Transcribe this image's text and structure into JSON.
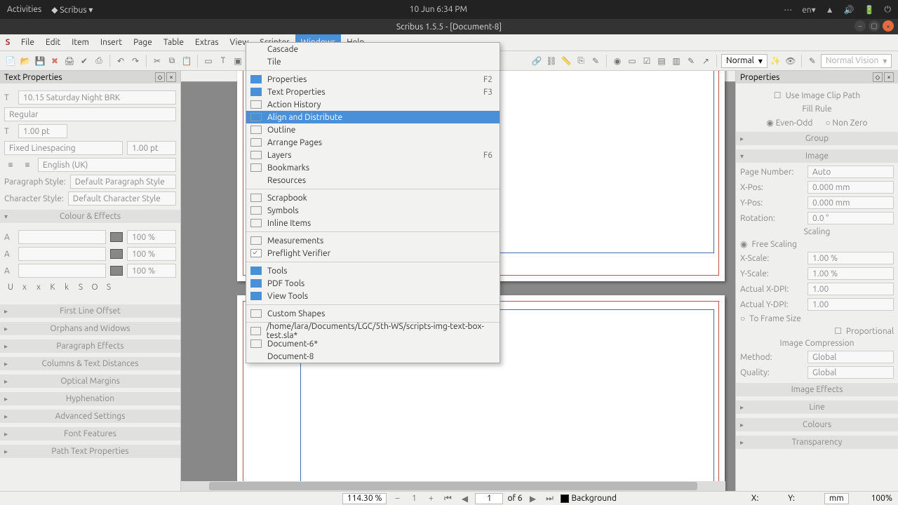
{
  "os": {
    "activities": "Activities",
    "app": "Scribus",
    "clock": "10 Jun   6:34 PM",
    "lang": "en"
  },
  "title": "Scribus 1.5.5 - [Document-8]",
  "menus": [
    "File",
    "Edit",
    "Item",
    "Insert",
    "Page",
    "Table",
    "Extras",
    "View",
    "Scripter",
    "Windows",
    "Help"
  ],
  "active_menu": "Windows",
  "toolbar": {
    "preview_mode": "Normal",
    "vision_mode": "Normal Vision"
  },
  "windows_menu": {
    "groups": [
      [
        {
          "label": "Cascade",
          "checked": null
        },
        {
          "label": "Tile",
          "checked": null
        }
      ],
      [
        {
          "label": "Properties",
          "checked": "on",
          "shortcut": "F2"
        },
        {
          "label": "Text Properties",
          "checked": "on",
          "shortcut": "F3"
        },
        {
          "label": "Action History",
          "checked": "off"
        },
        {
          "label": "Align and Distribute",
          "checked": "off",
          "highlight": true
        },
        {
          "label": "Outline",
          "checked": "off"
        },
        {
          "label": "Arrange Pages",
          "checked": "off"
        },
        {
          "label": "Layers",
          "checked": "off",
          "shortcut": "F6"
        },
        {
          "label": "Bookmarks",
          "checked": "off"
        },
        {
          "label": "Resources",
          "checked": null
        }
      ],
      [
        {
          "label": "Scrapbook",
          "checked": "off"
        },
        {
          "label": "Symbols",
          "checked": "off"
        },
        {
          "label": "Inline Items",
          "checked": "off"
        }
      ],
      [
        {
          "label": "Measurements",
          "checked": "off"
        },
        {
          "label": "Preflight Verifier",
          "checked": "tick"
        }
      ],
      [
        {
          "label": "Tools",
          "checked": "on"
        },
        {
          "label": "PDF Tools",
          "checked": "on"
        },
        {
          "label": "View Tools",
          "checked": "on"
        }
      ],
      [
        {
          "label": "Custom Shapes",
          "checked": "off"
        }
      ],
      [
        {
          "label": "/home/lara/Documents/LGC/5th-WS/scripts-img-text-box-test.sla*",
          "checked": "off"
        },
        {
          "label": "Document-6*",
          "checked": "off"
        },
        {
          "label": "Document-8",
          "checked": null
        }
      ]
    ]
  },
  "leftpanel": {
    "title": "Text Properties",
    "font": "10.15 Saturday Night BRK",
    "style_variant": "Regular",
    "size": "1.00 pt",
    "linespacing_type": "Fixed Linespacing",
    "linespacing_val": "1.00 pt",
    "language": "English (UK)",
    "para_label": "Paragraph Style:",
    "para_value": "Default Paragraph Style",
    "char_label": "Character Style:",
    "char_value": "Default Character Style",
    "colour_header": "Colour & Effects",
    "pct": "100 %",
    "sections": [
      "First Line Offset",
      "Orphans and Widows",
      "Paragraph Effects",
      "Columns & Text Distances",
      "Optical Margins",
      "Hyphenation",
      "Advanced Settings",
      "Font Features",
      "Path Text Properties"
    ]
  },
  "rightpanel": {
    "title": "Properties",
    "use_clip": "Use Image Clip Path",
    "fill_rule": "Fill Rule",
    "evenodd": "Even-Odd",
    "nonzero": "Non Zero",
    "group": "Group",
    "image": "Image",
    "page_label": "Page Number:",
    "page_value": "Auto",
    "xpos_label": "X-Pos:",
    "xpos_value": "0.000 mm",
    "ypos_label": "Y-Pos:",
    "ypos_value": "0.000 mm",
    "rot_label": "Rotation:",
    "rot_value": "0.0 °",
    "scaling": "Scaling",
    "free_scaling": "Free Scaling",
    "xscale_label": "X-Scale:",
    "xscale_value": "1.00 %",
    "yscale_label": "Y-Scale:",
    "yscale_value": "1.00 %",
    "axdpi_label": "Actual X-DPI:",
    "axdpi_value": "1.00",
    "aydpi_label": "Actual Y-DPI:",
    "aydpi_value": "1.00",
    "to_frame": "To Frame Size",
    "proportional": "Proportional",
    "compression": "Image Compression",
    "method_label": "Method:",
    "method_value": "Global",
    "quality_label": "Quality:",
    "quality_value": "Global",
    "effects": "Image Effects",
    "line": "Line",
    "colours": "Colours",
    "transparency": "Transparency"
  },
  "status": {
    "zoom": "114.30 %",
    "page_current": "1",
    "page_total": "of 6",
    "layer": "Background",
    "x_label": "X:",
    "y_label": "Y:",
    "unit": "mm",
    "final_zoom": "100%"
  }
}
